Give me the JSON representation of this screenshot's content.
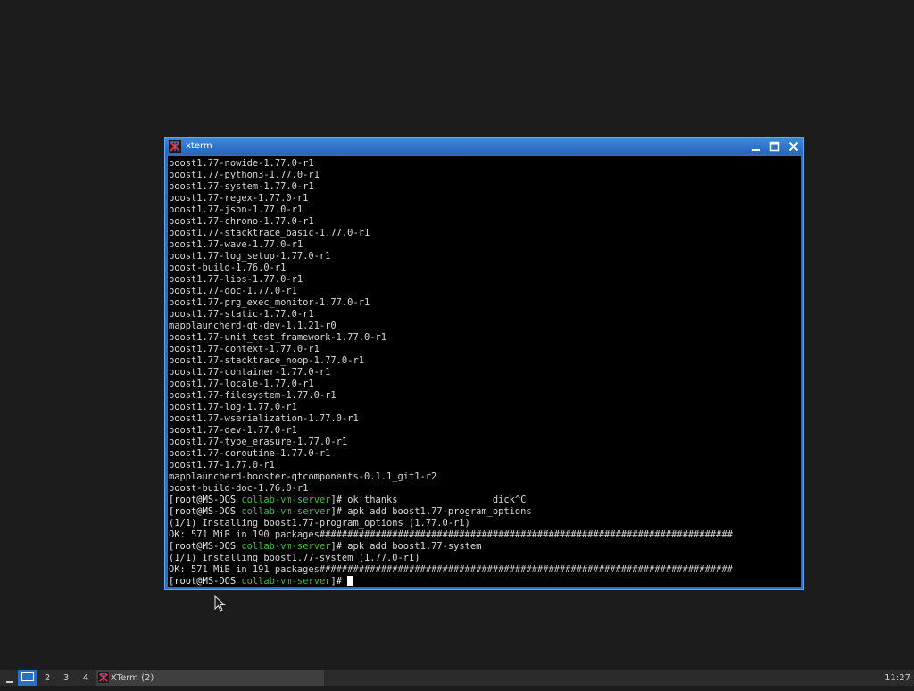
{
  "window": {
    "title": "xterm",
    "colors": {
      "titlebar": "#2a6fc4",
      "terminal_bg": "#000000",
      "prompt_dir": "#3cbf3c"
    }
  },
  "terminal": {
    "lines": [
      "boost1.77-nowide-1.77.0-r1",
      "boost1.77-python3-1.77.0-r1",
      "boost1.77-system-1.77.0-r1",
      "boost1.77-regex-1.77.0-r1",
      "boost1.77-json-1.77.0-r1",
      "boost1.77-chrono-1.77.0-r1",
      "boost1.77-stacktrace_basic-1.77.0-r1",
      "boost1.77-wave-1.77.0-r1",
      "boost1.77-log_setup-1.77.0-r1",
      "boost-build-1.76.0-r1",
      "boost1.77-libs-1.77.0-r1",
      "boost1.77-doc-1.77.0-r1",
      "boost1.77-prg_exec_monitor-1.77.0-r1",
      "boost1.77-static-1.77.0-r1",
      "mapplauncherd-qt-dev-1.1.21-r0",
      "boost1.77-unit_test_framework-1.77.0-r1",
      "boost1.77-context-1.77.0-r1",
      "boost1.77-stacktrace_noop-1.77.0-r1",
      "boost1.77-container-1.77.0-r1",
      "boost1.77-locale-1.77.0-r1",
      "boost1.77-filesystem-1.77.0-r1",
      "boost1.77-log-1.77.0-r1",
      "boost1.77-wserialization-1.77.0-r1",
      "boost1.77-dev-1.77.0-r1",
      "boost1.77-type_erasure-1.77.0-r1",
      "boost1.77-coroutine-1.77.0-r1",
      "boost1.77-1.77.0-r1",
      "mapplauncherd-booster-qtcomponents-0.1.1_git1-r2",
      "boost-build-doc-1.76.0-r1"
    ],
    "prompt": {
      "open": "[",
      "user": "root",
      "at": "@",
      "host": "MS-DOS",
      "dir": "collab-vm-server",
      "close": "]#"
    },
    "session": [
      {
        "type": "prompt",
        "cmd": " ok thanks                 dick^C"
      },
      {
        "type": "prompt",
        "cmd": " apk add boost1.77-program_options"
      },
      {
        "type": "out",
        "text": "(1/1) Installing boost1.77-program_options (1.77.0-r1)"
      },
      {
        "type": "out",
        "text": "OK: 571 MiB in 190 packages##########################################################################"
      },
      {
        "type": "prompt",
        "cmd": " apk add boost1.77-system"
      },
      {
        "type": "out",
        "text": "(1/1) Installing boost1.77-system (1.77.0-r1)"
      },
      {
        "type": "out",
        "text": "OK: 571 MiB in 191 packages##########################################################################"
      },
      {
        "type": "prompt",
        "cmd": " ",
        "cursor": true
      }
    ]
  },
  "taskbar": {
    "workspaces": [
      "2",
      "3",
      "4"
    ],
    "task_label": "XTerm (2)",
    "clock": "11:27",
    "colors": {
      "active_workspace": "#2a6fc4"
    }
  }
}
